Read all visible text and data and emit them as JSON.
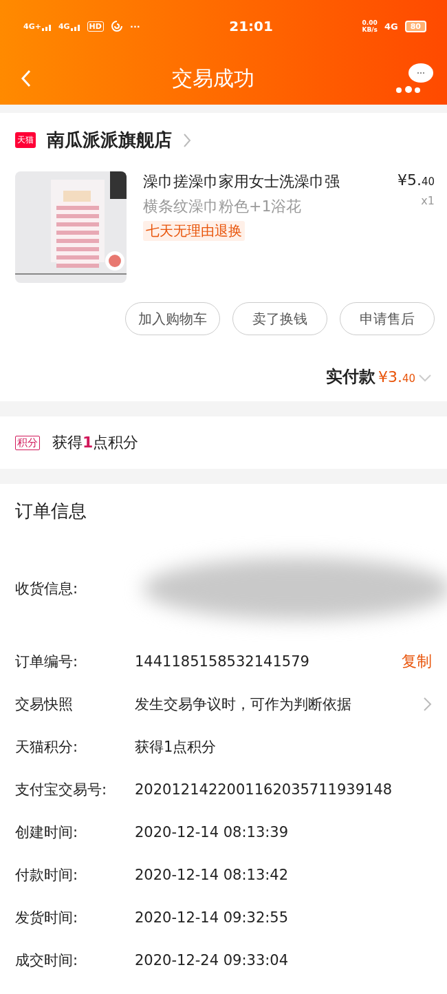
{
  "status_bar": {
    "signals": [
      "4G+",
      "4G"
    ],
    "hd": "HD",
    "more": "···",
    "time": "21:01",
    "net_speed": [
      "0.00",
      "KB/s"
    ],
    "network": "4G",
    "battery": "80"
  },
  "header": {
    "title": "交易成功"
  },
  "store": {
    "badge": "天猫",
    "name": "南瓜派派旗舰店",
    "product": {
      "kind": "picture",
      "title": "澡巾搓澡巾家用女士洗澡巾强",
      "sku": "横条纹澡巾粉色+1浴花",
      "tag": "七天无理由退换",
      "price": {
        "currency": "¥",
        "main": "5.",
        "fraction": "40"
      },
      "quantity": "x1"
    },
    "buttons": [
      "加入购物车",
      "卖了换钱",
      "申请售后"
    ],
    "paid": {
      "label": "实付款",
      "currency": "¥",
      "main": "3.",
      "fraction": "40"
    }
  },
  "points": {
    "badge": "积分",
    "text": "获得**1**点积分"
  },
  "order_info": {
    "title": "订单信息",
    "rows": [
      {
        "kind": "redacted",
        "label": "收货信息:"
      },
      {
        "kind": "copy",
        "label": "订单编号:",
        "value": "1441185158532141579",
        "action": "复制"
      },
      {
        "kind": "link",
        "label": "交易快照",
        "value": "发生交易争议时，可作为判断依据"
      },
      {
        "kind": "text",
        "label": "天猫积分:",
        "value": "获得1点积分"
      },
      {
        "kind": "text",
        "label": "支付宝交易号:",
        "value": "2020121422001162035711939148"
      },
      {
        "kind": "text",
        "label": "创建时间:",
        "value": "2020-12-14 08:13:39"
      },
      {
        "kind": "text",
        "label": "付款时间:",
        "value": "2020-12-14 08:13:42"
      },
      {
        "kind": "text",
        "label": "发货时间:",
        "value": "2020-12-14 09:32:55"
      },
      {
        "kind": "text",
        "label": "成交时间:",
        "value": "2020-12-24 09:33:04"
      }
    ]
  }
}
